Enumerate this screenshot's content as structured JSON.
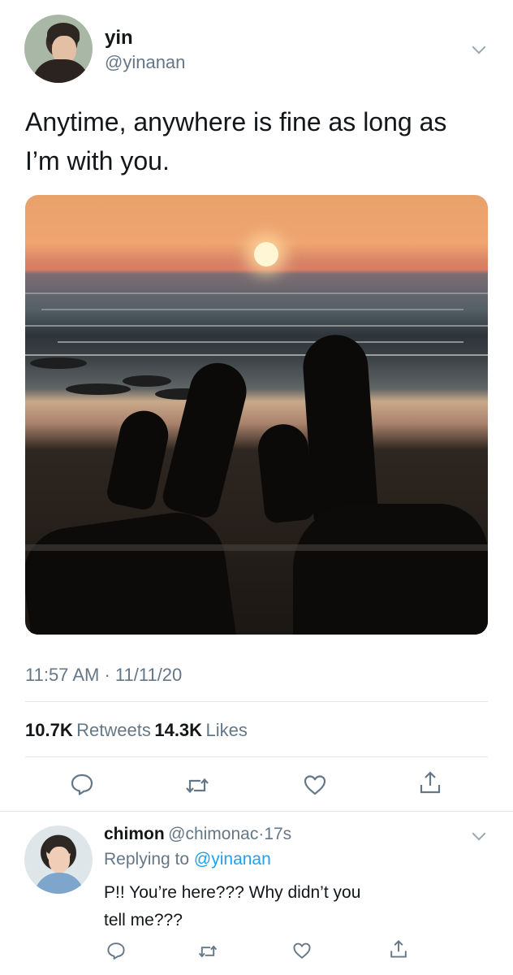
{
  "tweet": {
    "author": {
      "display_name": "yin",
      "handle": "@yinanan"
    },
    "text_line1": "Anytime, anywhere is fine as long as",
    "text_line2": "I’m with you.",
    "time": "11:57 AM",
    "separator": "·",
    "date": "11/11/20",
    "retweets_count": "10.7K",
    "retweets_label": "Retweets",
    "likes_count": "14.3K",
    "likes_label": "Likes"
  },
  "reply": {
    "author": {
      "display_name": "chimon",
      "handle": "@chimonac"
    },
    "separator": "·",
    "age": "17s",
    "replying_to_label": "Replying to",
    "replying_to_handle": "@yinanan",
    "text_line1": "P!! You’re here??? Why didn’t you",
    "text_line2": "tell me???"
  },
  "icons": {
    "reply": "reply-icon",
    "retweet": "retweet-icon",
    "like": "like-icon",
    "share": "share-icon",
    "more": "chevron-down-icon"
  },
  "colors": {
    "text": "#14171a",
    "secondary": "#657786",
    "link": "#1da1f2",
    "divider": "#e1e8ed"
  }
}
